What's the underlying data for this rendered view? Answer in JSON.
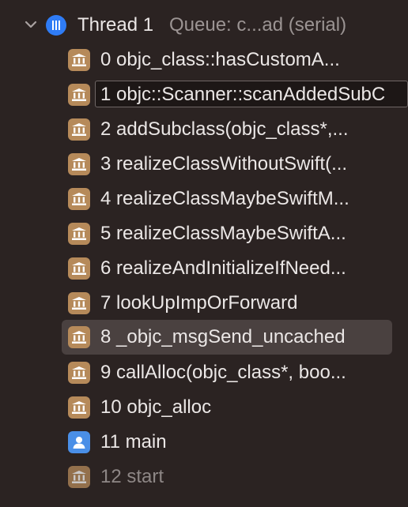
{
  "thread": {
    "title": "Thread 1",
    "queue": "Queue: c...ad (serial)",
    "icon": "thread-icon",
    "accent": "#2f7cf6"
  },
  "frames": [
    {
      "label": "0 objc_class::hasCustomA...",
      "icon": "library-icon"
    },
    {
      "label": "1 objc::Scanner::scanAddedSubC",
      "icon": "library-icon"
    },
    {
      "label": "2 addSubclass(objc_class*,...",
      "icon": "library-icon"
    },
    {
      "label": "3 realizeClassWithoutSwift(...",
      "icon": "library-icon"
    },
    {
      "label": "4 realizeClassMaybeSwiftM...",
      "icon": "library-icon"
    },
    {
      "label": "5 realizeClassMaybeSwiftA...",
      "icon": "library-icon"
    },
    {
      "label": "6 realizeAndInitializeIfNeed...",
      "icon": "library-icon"
    },
    {
      "label": "7 lookUpImpOrForward",
      "icon": "library-icon"
    },
    {
      "label": "8 _objc_msgSend_uncached",
      "icon": "library-icon"
    },
    {
      "label": "9 callAlloc(objc_class*, boo...",
      "icon": "library-icon"
    },
    {
      "label": "10 objc_alloc",
      "icon": "library-icon"
    },
    {
      "label": "11 main",
      "icon": "user-icon"
    },
    {
      "label": "12 start",
      "icon": "library-icon"
    }
  ],
  "colors": {
    "background": "#2b2322",
    "library_icon": "#b68a5a",
    "user_icon": "#4a8fe7",
    "selected_row": "#4a4140"
  }
}
